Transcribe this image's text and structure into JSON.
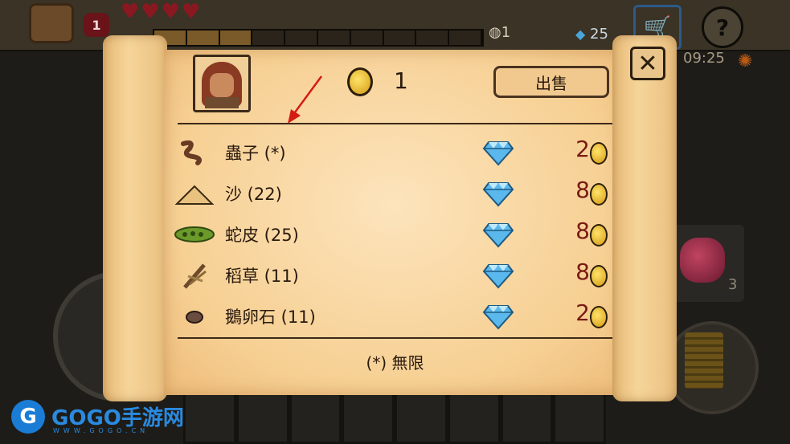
{
  "hud": {
    "level": "1",
    "hearts": "♥♥♥♥",
    "xp_segments_total": 10,
    "xp_segments_filled": 3,
    "stones": "1",
    "gems": "25",
    "clock": "09:25",
    "slot_item_count": "3"
  },
  "dialog": {
    "money": "1",
    "sell_label": "出售",
    "close_label": "✕",
    "footnote": "(*) 無限",
    "items": [
      {
        "name": "蟲子 (*)",
        "price": "2",
        "icon": "worm-icon",
        "color": "#6a3b22"
      },
      {
        "name": "沙 (22)",
        "price": "8",
        "icon": "sand-pile-icon",
        "color": "#e8c27e"
      },
      {
        "name": "蛇皮 (25)",
        "price": "8",
        "icon": "snake-skin-icon",
        "color": "#6b9a2a"
      },
      {
        "name": "稻草 (11)",
        "price": "8",
        "icon": "straw-icon",
        "color": "#6e4a2a"
      },
      {
        "name": "鵝卵石 (11)",
        "price": "2",
        "icon": "pebble-icon",
        "color": "#6a4c40"
      }
    ]
  },
  "watermark": {
    "logo": "G",
    "brand": "GOGO手游网",
    "url": "WWW.GOGO.CN"
  },
  "colors": {
    "parchment": "#f6cf92",
    "price_red": "#7a1a14",
    "gem_blue": "#5ab8ec",
    "coin_gold": "#ffd84a"
  }
}
